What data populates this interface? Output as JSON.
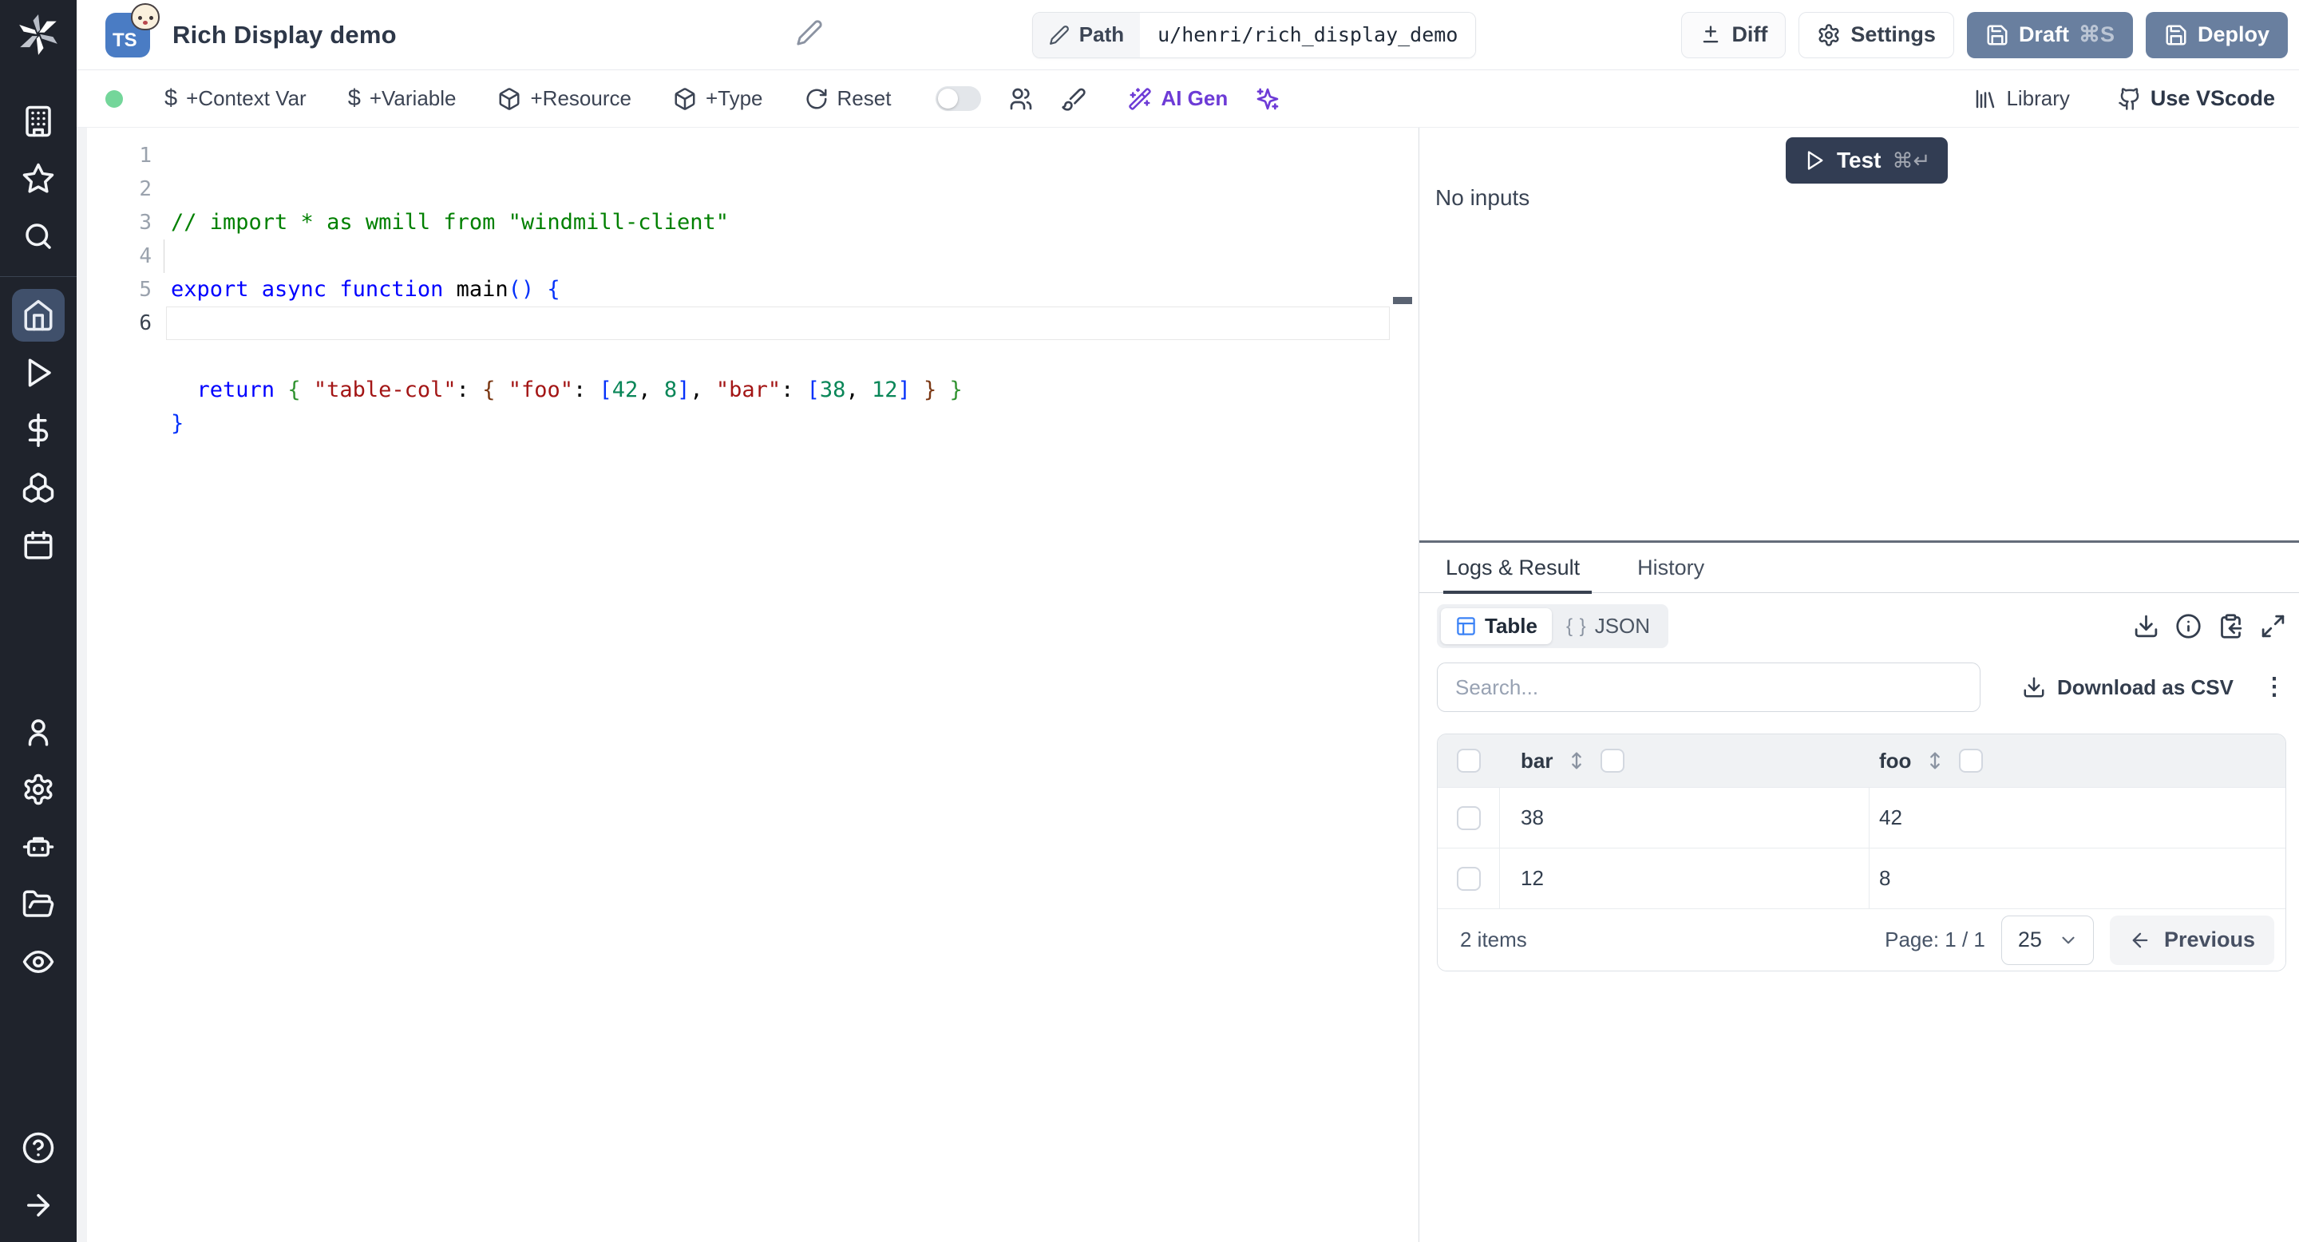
{
  "topbar": {
    "language_badge": "TS",
    "title": "Rich Display demo",
    "path_label": "Path",
    "path_value": "u/henri/rich_display_demo",
    "diff_label": "Diff",
    "settings_label": "Settings",
    "draft_label": "Draft",
    "draft_shortcut": "⌘S",
    "deploy_label": "Deploy"
  },
  "toolbar": {
    "status_color": "#74d69a",
    "items": [
      {
        "label": "+Context Var",
        "icon": "dollar-icon"
      },
      {
        "label": "+Variable",
        "icon": "dollar-icon"
      },
      {
        "label": "+Resource",
        "icon": "package-icon"
      },
      {
        "label": "+Type",
        "icon": "package-icon"
      },
      {
        "label": "Reset",
        "icon": "reset-icon"
      }
    ],
    "ai_gen_label": "AI Gen",
    "library_label": "Library",
    "use_vscode_label": "Use VScode",
    "accent_purple": "#6d3bd6"
  },
  "editor": {
    "line_numbers": [
      "1",
      "2",
      "3",
      "4",
      "5",
      "6"
    ],
    "active_line": "6",
    "token_colors": {
      "comment": "#008000",
      "keyword": "#0000ff",
      "string": "#a31515",
      "number": "#098658",
      "plain": "#000000",
      "b1": "#0431fa",
      "b2": "#319331",
      "b3": "#7b3814"
    },
    "lines": [
      [
        {
          "t": "// import * as wmill from \"windmill-client\"",
          "c": "comment"
        }
      ],
      [],
      [
        {
          "t": "export async function ",
          "c": "keyword"
        },
        {
          "t": "main",
          "c": "plain"
        },
        {
          "t": "() {",
          "c": "b1"
        }
      ],
      [
        {
          "t": "  ",
          "c": "plain"
        },
        {
          "t": "return",
          "c": "keyword"
        },
        {
          "t": " ",
          "c": "plain"
        },
        {
          "t": "{",
          "c": "b2"
        },
        {
          "t": " ",
          "c": "plain"
        },
        {
          "t": "\"table-col\"",
          "c": "string"
        },
        {
          "t": ": ",
          "c": "plain"
        },
        {
          "t": "{",
          "c": "b3"
        },
        {
          "t": " ",
          "c": "plain"
        },
        {
          "t": "\"foo\"",
          "c": "string"
        },
        {
          "t": ": ",
          "c": "plain"
        },
        {
          "t": "[",
          "c": "b1"
        },
        {
          "t": "42",
          "c": "number"
        },
        {
          "t": ", ",
          "c": "plain"
        },
        {
          "t": "8",
          "c": "number"
        },
        {
          "t": "]",
          "c": "b1"
        },
        {
          "t": ", ",
          "c": "plain"
        },
        {
          "t": "\"bar\"",
          "c": "string"
        },
        {
          "t": ": ",
          "c": "plain"
        },
        {
          "t": "[",
          "c": "b1"
        },
        {
          "t": "38",
          "c": "number"
        },
        {
          "t": ", ",
          "c": "plain"
        },
        {
          "t": "12",
          "c": "number"
        },
        {
          "t": "]",
          "c": "b1"
        },
        {
          "t": " ",
          "c": "plain"
        },
        {
          "t": "}",
          "c": "b3"
        },
        {
          "t": " ",
          "c": "plain"
        },
        {
          "t": "}",
          "c": "b2"
        }
      ],
      [
        {
          "t": "}",
          "c": "b1"
        }
      ],
      []
    ]
  },
  "run_panel": {
    "test_label": "Test",
    "test_shortcut": "⌘↵",
    "no_inputs": "No inputs",
    "tabs": [
      {
        "label": "Logs & Result"
      },
      {
        "label": "History"
      }
    ],
    "active_tab": "Logs & Result",
    "view_toggle": [
      {
        "label": "Table"
      },
      {
        "label": "JSON"
      }
    ],
    "braces_glyph": "{ }",
    "search_placeholder": "Search...",
    "download_csv_label": "Download as CSV",
    "table": {
      "columns": [
        {
          "label": "bar"
        },
        {
          "label": "foo"
        }
      ],
      "rows": [
        [
          "38",
          "42"
        ],
        [
          "12",
          "8"
        ]
      ],
      "items_label": "2 items",
      "page_label": "Page: 1 / 1",
      "page_size": "25",
      "previous_label": "Previous"
    }
  },
  "colors": {
    "sidebar_bg": "#1f232c",
    "sidebar_active_bg": "#40506b",
    "slate_button": "#697f9f",
    "test_button": "#323d53",
    "table_icon_blue": "#3b82f6",
    "header_gray": "#f0f2f4"
  }
}
